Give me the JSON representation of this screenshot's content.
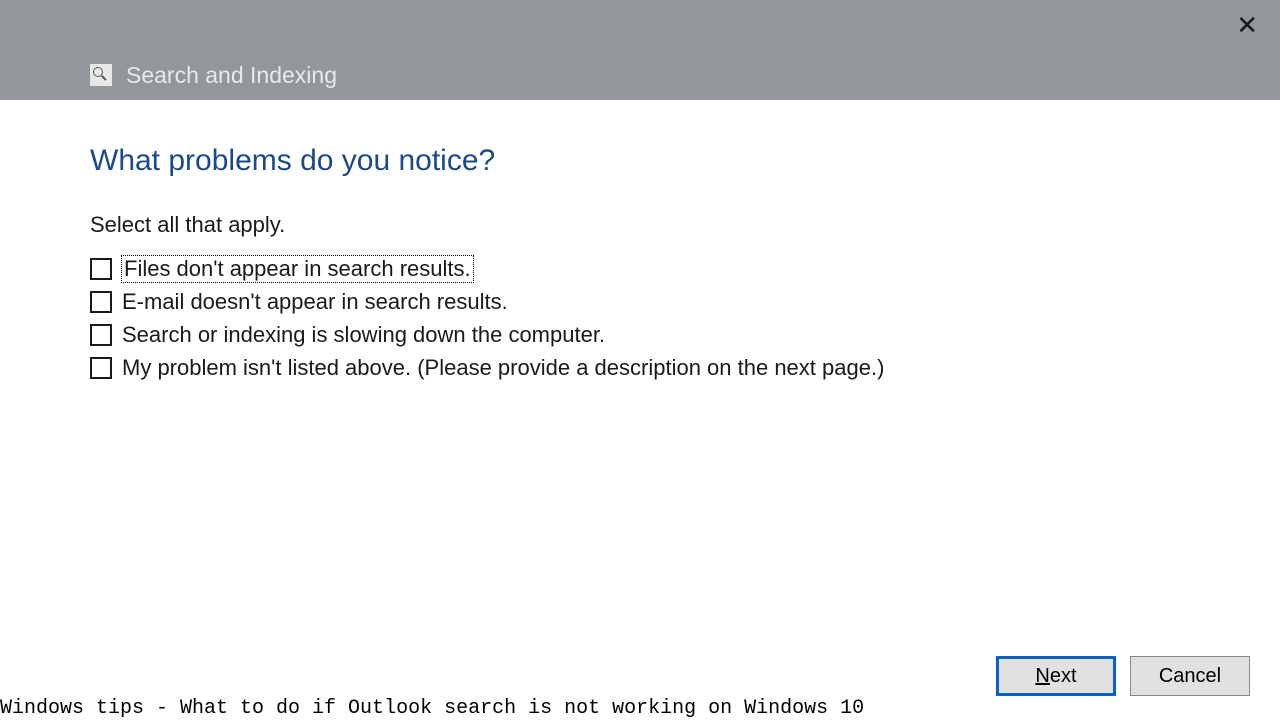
{
  "titlebar": {
    "title": "Search and Indexing"
  },
  "heading": "What problems do you notice?",
  "instruction": "Select all that apply.",
  "options": [
    {
      "label": "Files don't appear in search results.",
      "focused": true
    },
    {
      "label": "E-mail doesn't appear in search results.",
      "focused": false
    },
    {
      "label": "Search or indexing is slowing down the computer.",
      "focused": false
    },
    {
      "label": "My problem isn't listed above. (Please provide a description on the next page.)",
      "focused": false
    }
  ],
  "buttons": {
    "next": "Next",
    "cancel": "Cancel"
  },
  "caption": "Windows tips - What to do if Outlook search is not working on Windows 10"
}
